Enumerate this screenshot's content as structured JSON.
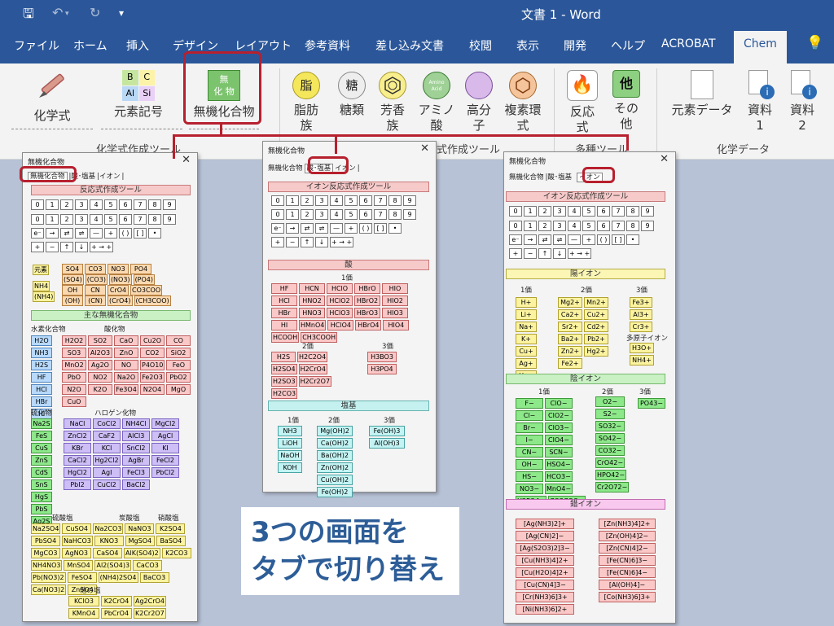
{
  "word": {
    "title": "文書 1  -  Word",
    "tabs": [
      "ファイル",
      "ホーム",
      "挿入",
      "デザイン",
      "レイアウト",
      "参考資料",
      "差し込み文書",
      "校閲",
      "表示",
      "開発",
      "ヘルプ",
      "ACROBAT",
      "Chem"
    ],
    "active_tab": "Chem",
    "ribbon": {
      "btn_kagakushiki": "化学式",
      "btn_genso": "元素記号",
      "btn_muki": "無機化合物",
      "btn_shibo": "脂肪",
      "btn_shibo2": "族",
      "btn_tourui": "糖類",
      "btn_houkou": "芳香",
      "btn_houkou2": "族",
      "btn_amino": "アミノ",
      "btn_amino2": "酸",
      "btn_koubun": "高分",
      "btn_koubun2": "子",
      "btn_fukuso": "複素環",
      "btn_fukuso2": "式",
      "btn_hannou": "反応",
      "btn_hannou2": "式",
      "btn_sonota": "その",
      "btn_sonota2": "他",
      "btn_genso_data": "元素データ",
      "btn_shiryo1": "資料",
      "btn_shiryo1_n": "1",
      "btn_shiryo2": "資料",
      "btn_shiryo2_n": "2",
      "icon_shibo": "脂",
      "icon_tou": "糖",
      "icon_sonota": "他",
      "icon_muki1": "無",
      "icon_muki2": "化 物",
      "icon_amino": "Amino Acid",
      "group_kagakushiki": "化学式作成ツール",
      "group_yuuki": "式作成ツール",
      "group_tasho": "多種ツール",
      "group_data": "化学データ",
      "periodic": [
        "B",
        "C",
        "Al",
        "Si"
      ]
    }
  },
  "panel1": {
    "title": "無機化合物",
    "tabs": [
      "無機化合物",
      "酸･塩基",
      "イオン"
    ],
    "h_reaction": "反応式作成ツール",
    "digits": [
      "0",
      "1",
      "2",
      "3",
      "4",
      "5",
      "6",
      "7",
      "8",
      "9"
    ],
    "subs": [
      "0",
      "1",
      "2",
      "3",
      "4",
      "5",
      "6",
      "7",
      "8",
      "9"
    ],
    "sym": [
      "e⁻",
      "→",
      "⇄",
      "⇌",
      "—",
      "+",
      "( )",
      "[ ]",
      "•"
    ],
    "sym2": [
      "+",
      "−",
      "↑",
      "↓",
      "+ → +"
    ],
    "genso": "元素",
    "ions1": [
      "SO4",
      "CO3",
      "NO3",
      "PO4"
    ],
    "ions1p": [
      "(SO4)",
      "(CO3)",
      "(NO3)",
      "(PO4)"
    ],
    "nh4": "NH4",
    "nh4p": "(NH4)",
    "ions2": [
      "OH",
      "CN",
      "CrO4",
      "CO3COO"
    ],
    "ions2p": [
      "(OH)",
      "(CN)",
      "(CrO4)",
      "(CH3COO)"
    ],
    "h_main": "主な無機化合物",
    "lbl_h": "水素化合物",
    "lbl_ox": "酸化物",
    "hyd": [
      "H2O",
      "NH3",
      "H2S",
      "HF",
      "HCl",
      "HBr",
      "HI"
    ],
    "ox": [
      "H2O2",
      "SO2",
      "CaO",
      "Cu2O",
      "CO",
      "SO3",
      "Al2O3",
      "ZnO",
      "CO2",
      "SiO2",
      "MnO2",
      "Ag2O",
      "NO",
      "P4O10",
      "FeO",
      "PbO",
      "NO2",
      "Na2O",
      "Fe2O3",
      "PbO2",
      "N2O",
      "K2O",
      "Fe3O4",
      "N2O4",
      "MgO",
      "CuO"
    ],
    "lbl_sulf": "硫化物",
    "lbl_hal": "ハロゲン化物",
    "sulf": [
      "Na2S",
      "FeS",
      "CuS",
      "ZnS",
      "CdS",
      "SnS",
      "HgS",
      "PbS",
      "Ag2S"
    ],
    "hal": [
      "NaCl",
      "CoCl2",
      "NH4Cl",
      "MgCl2",
      "ZnCl2",
      "CaF2",
      "AlCl3",
      "AgCl",
      "KBr",
      "KCl",
      "SnCl2",
      "KI",
      "CaCl2",
      "Hg2Cl2",
      "AgBr",
      "FeCl2",
      "HgCl2",
      "AgI",
      "FeCl3",
      "PbCl2",
      "PbI2",
      "CuCl2",
      "BaCl2"
    ],
    "lbl_sulfate": "硫酸塩",
    "lbl_carb": "炭酸塩",
    "lbl_nitr": "硝酸塩",
    "salts": [
      "Na2SO4",
      "CuSO4",
      "Na2CO3",
      "NaNO3",
      "K2SO4",
      "PbSO4",
      "NaHCO3",
      "KNO3",
      "MgSO4",
      "BaSO4",
      "MgCO3",
      "AgNO3",
      "CaSO4",
      "AlK(SO4)2",
      "K2CO3",
      "NH4NO3",
      "MnSO4",
      "Al2(SO4)3",
      "CaCO3",
      "Pb(NO3)2",
      "FeSO4",
      "(NH4)2SO4",
      "BaCO3",
      "Ca(NO3)2",
      "ZnSO4"
    ],
    "lbl_other": "他の塩",
    "other": [
      "KClO3",
      "K2CrO4",
      "Ag2CrO4",
      "KMnO4",
      "PbCrO4",
      "K2Cr2O7"
    ]
  },
  "panel2": {
    "title": "無機化合物",
    "tabs": [
      "無機化合物",
      "酸･塩基",
      "イオン"
    ],
    "h_ion": "イオン反応式作成ツール",
    "h_acid": "酸",
    "lbl_1": "1価",
    "acid1": [
      "HF",
      "HCN",
      "HClO",
      "HBrO",
      "HIO",
      "HCl",
      "HNO2",
      "HClO2",
      "HBrO2",
      "HIO2",
      "HBr",
      "HNO3",
      "HClO3",
      "HBrO3",
      "HIO3",
      "HI",
      "HMnO4",
      "HClO4",
      "HBrO4",
      "HIO4",
      "HCOOH",
      "CH3COOH"
    ],
    "lbl_2": "2価",
    "lbl_3": "3価",
    "acid2": [
      "H2S",
      "H2C2O4",
      "H2SO4",
      "H2CrO4",
      "H2SO3",
      "H2Cr2O7",
      "H2CO3"
    ],
    "acid3": [
      "H3BO3",
      "H3PO4"
    ],
    "h_base": "塩基",
    "base1": [
      "NH3",
      "LiOH",
      "NaOH",
      "KOH"
    ],
    "base2": [
      "Mg(OH)2",
      "Ca(OH)2",
      "Ba(OH)2",
      "Zn(OH)2",
      "Cu(OH)2",
      "Fe(OH)2"
    ],
    "base3": [
      "Fe(OH)3",
      "Al(OH)3"
    ]
  },
  "panel3": {
    "title": "無機化合物",
    "tabs": [
      "無機化合物",
      "酸･塩基",
      "イオン"
    ],
    "h_ion": "イオン反応式作成ツール",
    "h_cat": "陽イオン",
    "lbl_1": "1価",
    "lbl_2": "2価",
    "lbl_3": "3価",
    "cat1": [
      "H+",
      "Li+",
      "Na+",
      "K+",
      "Cu+",
      "Ag+",
      "Hg+"
    ],
    "cat2": [
      "Mg2+",
      "Mn2+",
      "Ca2+",
      "Cu2+",
      "Sr2+",
      "Cd2+",
      "Ba2+",
      "Pb2+",
      "Zn2+",
      "Hg2+",
      "Fe2+"
    ],
    "cat3": [
      "Fe3+",
      "Al3+",
      "Cr3+"
    ],
    "lbl_poly": "多原子イオン",
    "poly": [
      "H3O+",
      "NH4+"
    ],
    "h_an": "陰イオン",
    "an1": [
      "F−",
      "ClO−",
      "Cl−",
      "ClO2−",
      "Br−",
      "ClO3−",
      "I−",
      "ClO4−",
      "CN−",
      "SCN−",
      "OH−",
      "HSO4−",
      "HS−",
      "HCO3−",
      "NO3−",
      "MnO4−",
      "H2PO4−",
      "CO3COO−"
    ],
    "an2": [
      "O2−",
      "S2−",
      "SO32−",
      "SO42−",
      "CO32−",
      "CrO42−",
      "HPO42−",
      "Cr2O72−"
    ],
    "an3": [
      "PO43−"
    ],
    "h_comp": "錯イオン",
    "comp1": [
      "[Ag(NH3)2]+",
      "[Ag(CN)2]−",
      "[Ag(S2O3)2]3−",
      "[Cu(NH3)4]2+",
      "[Cu(H2O)4]2+",
      "[Cu(CN)4]3−",
      "[Cr(NH3)6]3+",
      "[Ni(NH3)6]2+"
    ],
    "comp2": [
      "[Zn(NH3)4]2+",
      "[Zn(OH)4]2−",
      "[Zn(CN)4]2−",
      "[Fe(CN)6]3−",
      "[Fe(CN)6]4−",
      "[Al(OH)4]−",
      "[Co(NH3)6]3+"
    ]
  },
  "caption": {
    "line1": "3つの画面を",
    "line2": "タブで切り替え"
  }
}
